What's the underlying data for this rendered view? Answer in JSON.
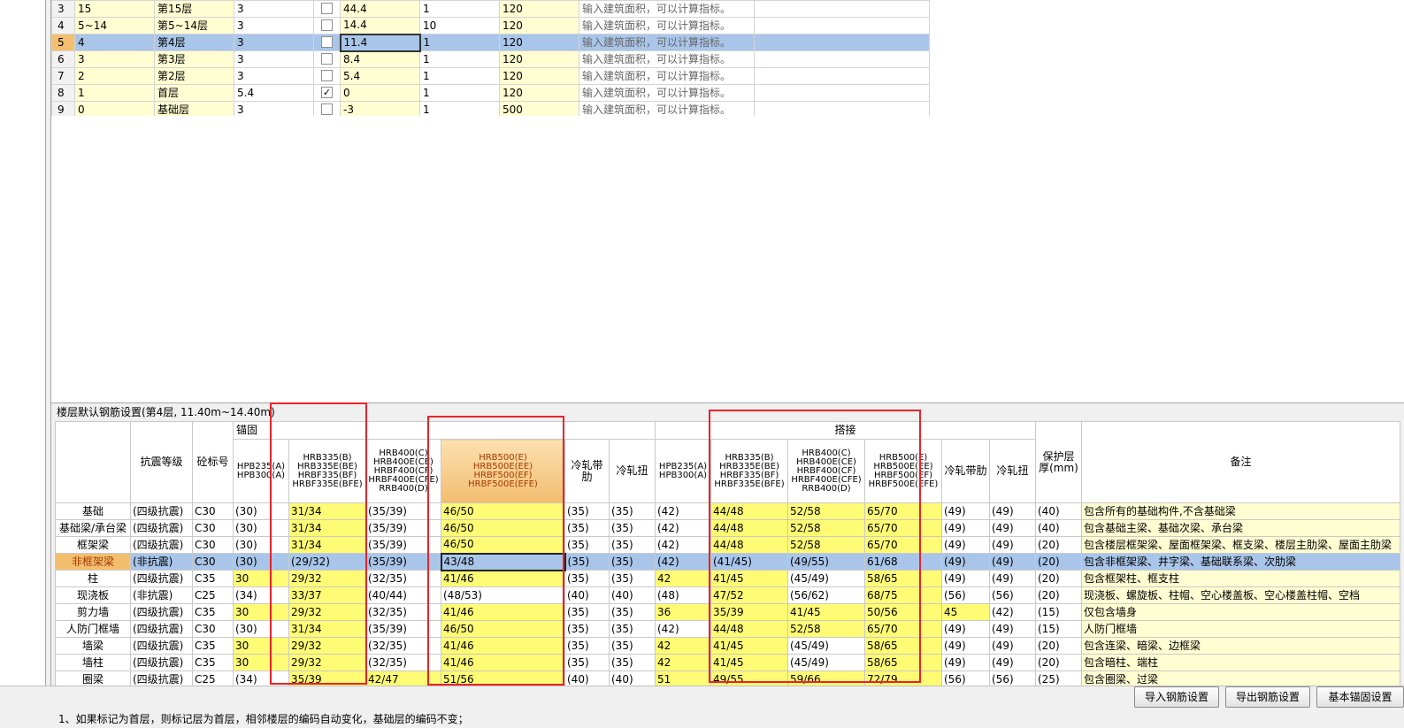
{
  "floor_grid": {
    "rows": [
      {
        "idx": "3",
        "code": "15",
        "name": "第15层",
        "height": "3",
        "first": false,
        "elev": "44.4",
        "count": "1",
        "slab": "120",
        "remark": "输入建筑面积，可以计算指标。"
      },
      {
        "idx": "4",
        "code": "5~14",
        "name": "第5~14层",
        "height": "3",
        "first": false,
        "elev": "14.4",
        "count": "10",
        "slab": "120",
        "remark": "输入建筑面积，可以计算指标。"
      },
      {
        "idx": "5",
        "code": "4",
        "name": "第4层",
        "height": "3",
        "first": false,
        "elev": "11.4",
        "count": "1",
        "slab": "120",
        "remark": "输入建筑面积，可以计算指标。",
        "selected": true
      },
      {
        "idx": "6",
        "code": "3",
        "name": "第3层",
        "height": "3",
        "first": false,
        "elev": "8.4",
        "count": "1",
        "slab": "120",
        "remark": "输入建筑面积，可以计算指标。"
      },
      {
        "idx": "7",
        "code": "2",
        "name": "第2层",
        "height": "3",
        "first": false,
        "elev": "5.4",
        "count": "1",
        "slab": "120",
        "remark": "输入建筑面积，可以计算指标。"
      },
      {
        "idx": "8",
        "code": "1",
        "name": "首层",
        "height": "5.4",
        "first": true,
        "elev": "0",
        "count": "1",
        "slab": "120",
        "remark": "输入建筑面积，可以计算指标。"
      },
      {
        "idx": "9",
        "code": "0",
        "name": "基础层",
        "height": "3",
        "first": false,
        "elev": "-3",
        "count": "1",
        "slab": "500",
        "remark": "输入建筑面积，可以计算指标。"
      }
    ]
  },
  "rebar_section": {
    "title": "楼层默认钢筋设置(第4层, 11.40m~14.40m)",
    "headers": {
      "seismic": "抗震等级",
      "concrete": "砼标号",
      "anchor_group": "锚固",
      "lap_group": "搭接",
      "hpb": "HPB235(A) HPB300(A)",
      "hrb335": "HRB335(B) HRB335E(BE) HRBF335(BF) HRBF335E(BFE)",
      "hrb400": "HRB400(C) HRB400E(CE) HRBF400(CF) HRBF400E(CFE) RRB400(D)",
      "hrb500": "HRB500(E) HRB500E(EE) HRBF500(EF) HRBF500E(EFE)",
      "cold_rib": "冷轧带肋",
      "cold_twist": "冷轧扭",
      "cover": "保护层厚(mm)",
      "remark": "备注"
    },
    "rows": [
      {
        "name": "基础",
        "seis": "(四级抗震)",
        "conc": "C30",
        "a1": "(30)",
        "a2": "31/34",
        "a3": "(35/39)",
        "a4": "46/50",
        "a5": "(35)",
        "a6": "(35)",
        "l1": "(42)",
        "l2": "44/48",
        "l3": "52/58",
        "l4": "65/70",
        "l5": "(49)",
        "l6": "(49)",
        "cov": "(40)",
        "rem": "包含所有的基础构件,不含基础梁"
      },
      {
        "name": "基础梁/承台梁",
        "seis": "(四级抗震)",
        "conc": "C30",
        "a1": "(30)",
        "a2": "31/34",
        "a3": "(35/39)",
        "a4": "46/50",
        "a5": "(35)",
        "a6": "(35)",
        "l1": "(42)",
        "l2": "44/48",
        "l3": "52/58",
        "l4": "65/70",
        "l5": "(49)",
        "l6": "(49)",
        "cov": "(40)",
        "rem": "包含基础主梁、基础次梁、承台梁"
      },
      {
        "name": "框架梁",
        "seis": "(四级抗震)",
        "conc": "C30",
        "a1": "(30)",
        "a2": "31/34",
        "a3": "(35/39)",
        "a4": "46/50",
        "a5": "(35)",
        "a6": "(35)",
        "l1": "(42)",
        "l2": "44/48",
        "l3": "52/58",
        "l4": "65/70",
        "l5": "(49)",
        "l6": "(49)",
        "cov": "(20)",
        "rem": "包含楼层框架梁、屋面框架梁、框支梁、楼层主肋梁、屋面主肋梁"
      },
      {
        "name": "非框架梁",
        "seis": "(非抗震)",
        "conc": "C30",
        "a1": "(30)",
        "a2": "(29/32)",
        "a3": "(35/39)",
        "a4": "43/48",
        "a5": "(35)",
        "a6": "(35)",
        "l1": "(42)",
        "l2": "(41/45)",
        "l3": "(49/55)",
        "l4": "61/68",
        "l5": "(49)",
        "l6": "(49)",
        "cov": "(20)",
        "rem": "包含非框架梁、井字梁、基础联系梁、次肋梁",
        "selected": true
      },
      {
        "name": "柱",
        "seis": "(四级抗震)",
        "conc": "C35",
        "a1": "30",
        "a2": "29/32",
        "a3": "(32/35)",
        "a4": "41/46",
        "a5": "(35)",
        "a6": "(35)",
        "l1": "42",
        "l2": "41/45",
        "l3": "(45/49)",
        "l4": "58/65",
        "l5": "(49)",
        "l6": "(49)",
        "cov": "(20)",
        "rem": "包含框架柱、框支柱"
      },
      {
        "name": "现浇板",
        "seis": "(非抗震)",
        "conc": "C25",
        "a1": "(34)",
        "a2": "33/37",
        "a3": "(40/44)",
        "a4": "(48/53)",
        "a5": "(40)",
        "a6": "(40)",
        "l1": "(48)",
        "l2": "47/52",
        "l3": "(56/62)",
        "l4": "68/75",
        "l5": "(56)",
        "l6": "(56)",
        "cov": "(20)",
        "rem": "现浇板、螺旋板、柱帽、空心楼盖板、空心楼盖柱帽、空档"
      },
      {
        "name": "剪力墙",
        "seis": "(四级抗震)",
        "conc": "C35",
        "a1": "30",
        "a2": "29/32",
        "a3": "(32/35)",
        "a4": "41/46",
        "a5": "(35)",
        "a6": "(35)",
        "l1": "36",
        "l2": "35/39",
        "l3": "41/45",
        "l4": "50/56",
        "l5": "45",
        "l6": "(42)",
        "cov": "(15)",
        "rem": "仅包含墙身"
      },
      {
        "name": "人防门框墙",
        "seis": "(四级抗震)",
        "conc": "C30",
        "a1": "(30)",
        "a2": "31/34",
        "a3": "(35/39)",
        "a4": "46/50",
        "a5": "(35)",
        "a6": "(35)",
        "l1": "(42)",
        "l2": "44/48",
        "l3": "52/58",
        "l4": "65/70",
        "l5": "(49)",
        "l6": "(49)",
        "cov": "(15)",
        "rem": "人防门框墙"
      },
      {
        "name": "墙梁",
        "seis": "(四级抗震)",
        "conc": "C35",
        "a1": "30",
        "a2": "29/32",
        "a3": "(32/35)",
        "a4": "41/46",
        "a5": "(35)",
        "a6": "(35)",
        "l1": "42",
        "l2": "41/45",
        "l3": "(45/49)",
        "l4": "58/65",
        "l5": "(49)",
        "l6": "(49)",
        "cov": "(20)",
        "rem": "包含连梁、暗梁、边框梁"
      },
      {
        "name": "墙柱",
        "seis": "(四级抗震)",
        "conc": "C35",
        "a1": "30",
        "a2": "29/32",
        "a3": "(32/35)",
        "a4": "41/46",
        "a5": "(35)",
        "a6": "(35)",
        "l1": "42",
        "l2": "41/45",
        "l3": "(45/49)",
        "l4": "58/65",
        "l5": "(49)",
        "l6": "(49)",
        "cov": "(20)",
        "rem": "包含暗柱、端柱"
      },
      {
        "name": "圈梁",
        "seis": "(四级抗震)",
        "conc": "C25",
        "a1": "(34)",
        "a2": "35/39",
        "a3": "42/47",
        "a4": "51/56",
        "a5": "(40)",
        "a6": "(40)",
        "l1": "51",
        "l2": "49/55",
        "l3": "59/66",
        "l4": "72/79",
        "l5": "(56)",
        "l6": "(56)",
        "cov": "(25)",
        "rem": "包含圈梁、过梁"
      }
    ]
  },
  "buttons": {
    "import": "导入钢筋设置",
    "export": "导出钢筋设置",
    "basic": "基本锚固设置"
  },
  "note": "1、如果标记为首层，则标记层为首层，相邻楼层的编码自动变化，基础层的编码不变；",
  "colors": {
    "selected_row": "#a9c6ea",
    "selected_rownum": "#f3bf6f",
    "yellow_cell": "#fffb74",
    "light_yellow_cell": "#fffdd2",
    "highlight_box": "#e8232b"
  }
}
